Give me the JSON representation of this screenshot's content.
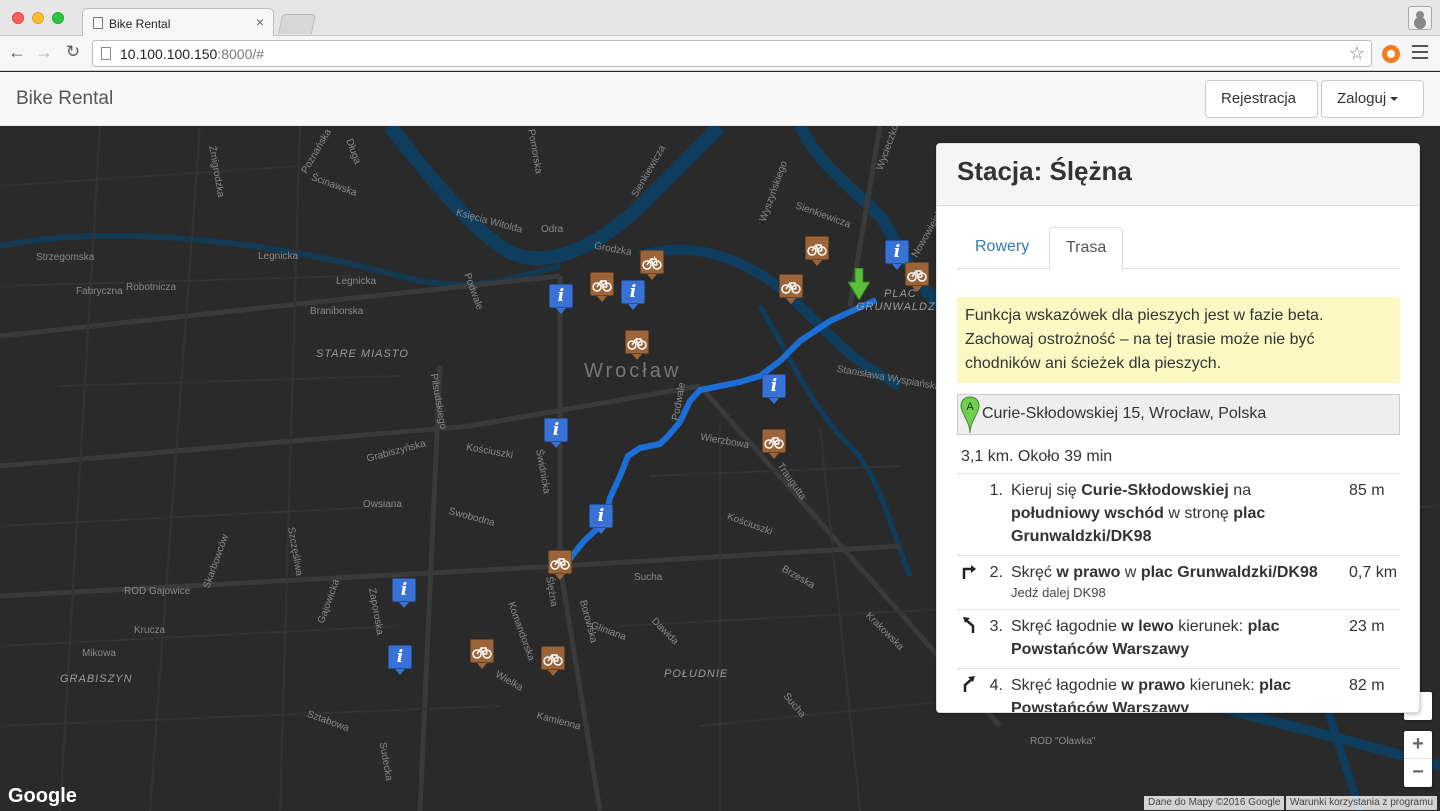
{
  "browser": {
    "tab_title": "Bike Rental",
    "tab_close": "×",
    "url_host": "10.100.100.150",
    "url_rest": ":8000/#"
  },
  "navbar": {
    "brand": "Bike Rental",
    "register_label": "Rejestracja",
    "login_label": "Zaloguj"
  },
  "map": {
    "city_label": "Wrocław",
    "districts": [
      "STARE MIASTO",
      "GRABISZYN",
      "PLAC",
      "GRUNWALDZKI",
      "ROD Gajowice",
      "POŁUDNIE",
      "ROD \"Oławka\""
    ],
    "streets": [
      "Poznańska",
      "Długa",
      "Ścinawska",
      "Żmigrodzka",
      "Legnicka",
      "Fabryczna",
      "Robotnicza",
      "Braniborska",
      "Strzegomska",
      "Legnicka",
      "Księcia Witolda",
      "Odra",
      "Grodzka",
      "Podwale",
      "Piłsudskiego",
      "Kościuszki",
      "Świdnicka",
      "Grabiszyńska",
      "Owsiana",
      "Swobodna",
      "Ślężna",
      "Wielka",
      "Borowska",
      "Gliniana",
      "Suchа",
      "Krucza",
      "Mikowa",
      "Sztabowa",
      "Kamienna",
      "Dawida",
      "Brzeska",
      "Kościuszki",
      "Traugutta",
      "Krakowska",
      "Sienkiewicza",
      "Wyszyńskiego",
      "Pomorska",
      "Wycieczkowa",
      "Stanisława Wyspiańskiego",
      "Zaporoska",
      "Gajowicka",
      "Skarbowców",
      "Sudecka",
      "Szczęśliwa",
      "Sucha",
      "Komandorska",
      "Podwale",
      "Wierzbowa",
      "Sienkiewicza",
      "Nowowiejska"
    ],
    "zoom_in": "+",
    "zoom_out": "−",
    "google": "Google",
    "attribution": "Dane do Mapy ©2016 Google",
    "terms": "Warunki korzystania z programu"
  },
  "panel": {
    "title": "Stacja: Ślężna",
    "tabs": [
      "Rowery",
      "Trasa"
    ],
    "active_tab": "Trasa",
    "warning": "Funkcja wskazówek dla pieszych jest w fazie beta. Zachowaj ostrożność – na tej trasie może nie być chodników ani ścieżek dla pieszych.",
    "start_marker": "A",
    "start_address": "Curie-Skłodowskiej 15, Wrocław, Polska",
    "summary": "3,1 km. Około 39 min",
    "steps": [
      {
        "num": "1.",
        "dist": "85 m"
      },
      {
        "num": "2.",
        "dist": "0,7 km",
        "sub": "Jedź dalej DK98"
      },
      {
        "num": "3.",
        "dist": "23 m"
      },
      {
        "num": "4.",
        "dist": "82 m"
      }
    ]
  },
  "colors": {
    "route": "#1c6fd6",
    "river": "#0f3d5e",
    "info_marker": "#3872d6",
    "bike_marker": "#9b6439",
    "warning_bg": "#fcf8c3",
    "link": "#337ab7"
  }
}
